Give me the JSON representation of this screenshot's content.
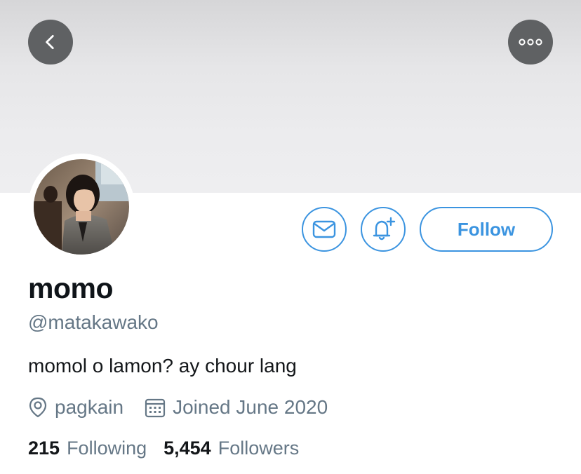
{
  "header": {
    "back_icon": "chevron-left-icon",
    "more_icon": "more-horizontal-icon"
  },
  "profile": {
    "display_name": "momo",
    "handle": "@matakawako",
    "bio": "momol o lamon? ay chour lang",
    "location": "pagkain",
    "joined": "Joined June 2020"
  },
  "actions": {
    "message_icon": "mail-icon",
    "notify_icon": "bell-plus-icon",
    "follow_label": "Follow"
  },
  "stats": {
    "following_count": "215",
    "following_label": "Following",
    "followers_count": "5,454",
    "followers_label": "Followers"
  },
  "colors": {
    "accent": "#3b94e0",
    "secondary_text": "#657786",
    "primary_text": "#14171a",
    "header_button": "#5f6163"
  }
}
